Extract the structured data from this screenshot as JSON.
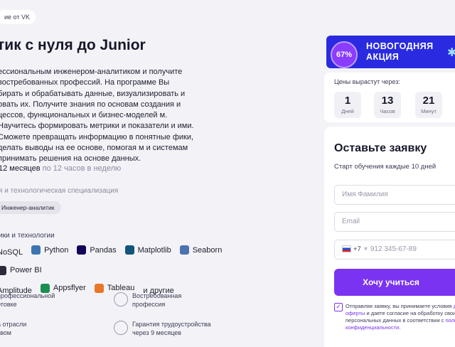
{
  "vk_pill": "ие от VK",
  "title": "тик с нуля до Junior",
  "description": "ессиональным инженером-аналитиком и получите востребованных профессий. На программе Вы бирать и обрабатывать данные, визуализировать и овать их. Получите знания по основам создания и цессов, функциональных и бизнес-моделей м. Научитесь формировать метрики и показатели и ими. Сможете превращать информацию в понятные фики, делать выводы на ее основе, помогая м и системам принимать решения на основе данных.",
  "duration": {
    "months": "12 месяцев",
    "rest": "по 12 часов в неделю"
  },
  "specialization": {
    "label": "я и технологическая специализация",
    "chip": "Инженер-аналитик"
  },
  "tools": {
    "label": "ики и технологии",
    "items": [
      {
        "label": "NoSQL",
        "icon": "none",
        "color": ""
      },
      {
        "label": "Python",
        "icon": "python-icon",
        "color": "#3b76b0"
      },
      {
        "label": "Pandas",
        "icon": "pandas-icon",
        "color": "#150458"
      },
      {
        "label": "Matplotlib",
        "icon": "matplotlib-icon",
        "color": "#11557c"
      },
      {
        "label": "Seaborn",
        "icon": "seaborn-icon",
        "color": "#4c72b0"
      },
      {
        "label": "Power BI",
        "icon": "powerbi-icon",
        "color": "#2b2b3b"
      },
      {
        "label": "Amplitude",
        "icon": "none",
        "color": ""
      },
      {
        "label": "Appsflyer",
        "icon": "appsflyer-icon",
        "color": "#1b8f4f"
      },
      {
        "label": "Tableau",
        "icon": "tableau-icon",
        "color": "#e97627"
      },
      {
        "label": "и другие",
        "icon": "none",
        "color": ""
      }
    ]
  },
  "features": [
    {
      "text": "профессиональной\nотовке",
      "icon": "none"
    },
    {
      "text": "Востребованная\nпрофессия",
      "icon": "clipboard-icon"
    },
    {
      "text": "а отрасли\nтвом",
      "icon": "none"
    },
    {
      "text": "Гарантия трудоустройства\nчерез 9 месяцев",
      "icon": "shield-icon"
    }
  ],
  "promo": {
    "badge": "67%",
    "line1": "НОВОГОДНЯЯ",
    "line2": "АКЦИЯ"
  },
  "timer": {
    "label": "Цены вырастут через:",
    "units": [
      {
        "value": "1",
        "unit": "Дней"
      },
      {
        "value": "13",
        "unit": "Часов"
      },
      {
        "value": "21",
        "unit": "Минут"
      }
    ]
  },
  "form": {
    "heading": "Оставьте заявку",
    "subheading": "Старт обучения каждые 10 дней",
    "name_placeholder": "Имя Фамилия",
    "email_placeholder": "Email",
    "phone_code": "+7",
    "phone_placeholder": "912 345-67-89",
    "submit": "Хочу учиться",
    "consent": {
      "text1": "Отправляя заявку, вы принимаете условия ",
      "link1": "д",
      "link1b": "оферты",
      "text2": " и даете согласие на обработку свои персональных данных в соответствии с ",
      "link2": "поли конфиденциальности",
      "text3": "."
    }
  }
}
